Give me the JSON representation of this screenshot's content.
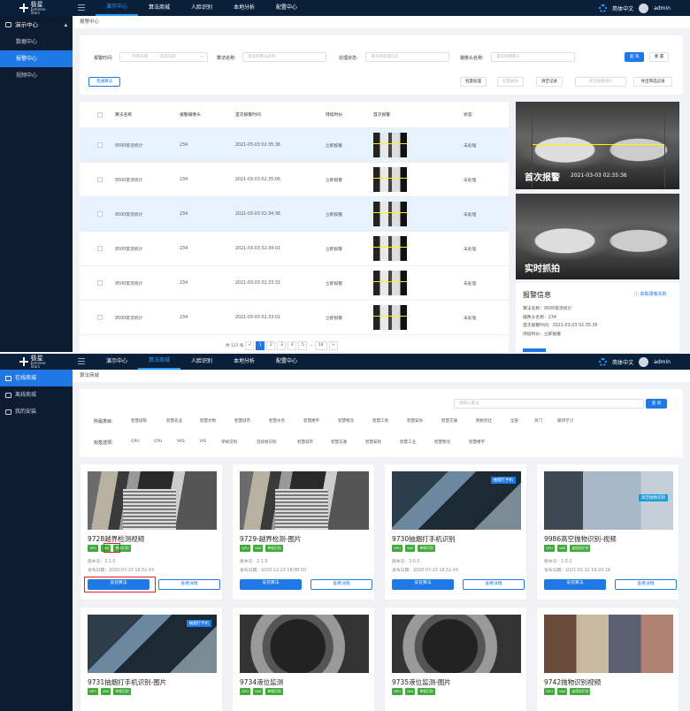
{
  "top": {
    "logo_main": "极星",
    "logo_sub": "Extreme Stars",
    "nav_items": [
      "演示中心",
      "算法商城",
      "人脸识别",
      "本地分析",
      "配置中心"
    ],
    "lang": "简体中文",
    "user": "admin"
  },
  "screen1": {
    "sidebar": {
      "group": "演示中心",
      "items": [
        "数据中心",
        "报警中心",
        "视频中心"
      ]
    },
    "breadcrumb": "报警中心",
    "filters": {
      "time_label": "报警时间:",
      "start_ph": "开始日期",
      "sep": "-",
      "end_ph": "结束日期",
      "algo_label": "算法名称:",
      "algo_ph": "请选择算法名称",
      "status_label": "处理状态:",
      "status_ph": "请选择处理状态",
      "cam_label": "摄像头名称:",
      "cam_ph": "请选择摄像头",
      "query": "查 询",
      "reset": "重 置"
    },
    "actions": {
      "normal": "普通算法",
      "batch": "批量处理",
      "batch_delete": "批量删除",
      "clear": "清空记录",
      "export_img": "导出报警图片",
      "export_rec": "导出筛选记录"
    },
    "table": {
      "headers": [
        "算法名称",
        "报警摄像头",
        "首次报警时间",
        "持续时长",
        "首次报警",
        "状态"
      ],
      "rows": [
        {
          "name": "9500客流统计",
          "cam": "234",
          "time": "2021-03-03 02:35:36",
          "dur": "立即报警",
          "status": "未处理"
        },
        {
          "name": "9500客流统计",
          "cam": "234",
          "time": "2021-03-03 02:35:06",
          "dur": "立即报警",
          "status": "未处理"
        },
        {
          "name": "9500客流统计",
          "cam": "234",
          "time": "2021-03-03 02:34:36",
          "dur": "立即报警",
          "status": "未处理"
        },
        {
          "name": "9500客流统计",
          "cam": "234",
          "time": "2021-03-03 02:34:01",
          "dur": "立即报警",
          "status": "未处理"
        },
        {
          "name": "9500客流统计",
          "cam": "234",
          "time": "2021-03-03 02:33:31",
          "dur": "立即报警",
          "status": "未处理"
        },
        {
          "name": "9500客流统计",
          "cam": "234",
          "time": "2021-03-03 02:33:01",
          "dur": "立即报警",
          "status": "未处理"
        }
      ]
    },
    "pager": {
      "total": "共 137 条",
      "prev": "<",
      "pages": [
        "1",
        "2",
        "3",
        "4",
        "5",
        "···",
        "14"
      ],
      "next": ">"
    },
    "preview": {
      "first_label": "首次报警",
      "first_time": "2021-03-03 02:35:36",
      "live_label": "实时抓拍",
      "info_title": "报警信息",
      "info_link": "获取录像失败",
      "info_lines": [
        "算法名称：9500客流统计",
        "摄像头名称：234",
        "首次报警时间：2021-03-03 02:35:36",
        "持续时长：立即报警"
      ]
    }
  },
  "screen2": {
    "sidebar": {
      "items": [
        "在线商城",
        "离线商城",
        "我的安装"
      ]
    },
    "breadcrumb": "算法商城",
    "search": {
      "placeholder": "请输入算法",
      "button": "查 询"
    },
    "category_label": "所属类目:",
    "categories": [
      "智慧城管",
      "智慧农业",
      "智慧文物",
      "智慧城市",
      "智慧水务",
      "智慧楼宇",
      "智慧物流",
      "智慧工地",
      "智慧安防",
      "智慧交通",
      "明厨亮灶",
      "全部",
      "热门",
      "联邦学习"
    ],
    "tag_label": "标签选项:",
    "tags": [
      "GPU",
      "CPU",
      "VAS",
      "IAS",
      "单帧识别",
      "连续帧识别",
      "智慧城市",
      "智慧交通",
      "智慧安防",
      "智慧工业",
      "智慧物流",
      "智慧楼宇"
    ],
    "cards": [
      {
        "title": "9728越界检测视频",
        "chips": [
          "GPU",
          "VAS",
          "单帧识别"
        ],
        "version": "版本号：2.1.0",
        "date": "发布日期：2020-07-23 16:32:43",
        "install": "安装算法",
        "detail": "查看详情",
        "img_label": ""
      },
      {
        "title": "9729-越界检测-图片",
        "chips": [
          "GPU",
          "VAS",
          "单帧识别"
        ],
        "version": "版本号：2.1.0",
        "date": "发布日期：2020-12-23 18:08:50",
        "install": "安装算法",
        "detail": "查看详情",
        "img_label": ""
      },
      {
        "title": "9730抽烟打手机识别",
        "chips": [
          "GPU",
          "VAS",
          "单帧识别"
        ],
        "version": "版本号：2.0.0",
        "date": "发布日期：2020-07-23 16:32:43",
        "install": "安装算法",
        "detail": "查看详情",
        "img_label": "抽烟打手机"
      },
      {
        "title": "9986高空抛物识别-视频",
        "chips": [
          "GPU",
          "VAS",
          "连续帧识别"
        ],
        "version": "版本号：1.0.2",
        "date": "发布日期：2021-01-12 16:20:18",
        "install": "安装算法",
        "detail": "查看详情",
        "img_label": "高空抛物识别"
      },
      {
        "title": "9731抽烟打手机识别-图片",
        "chips": [
          "GPU",
          "VAS",
          "单帧识别"
        ],
        "img_label": "抽烟打手机"
      },
      {
        "title": "9734液位监测",
        "chips": [
          "GPU",
          "VAS",
          "单帧识别"
        ],
        "img_label": ""
      },
      {
        "title": "9735液位监测-图片",
        "chips": [
          "GPU",
          "VAS",
          "单帧识别"
        ],
        "img_label": ""
      },
      {
        "title": "9742抛物识别视频",
        "chips": [
          "GPU",
          "VAS",
          "连续帧识别"
        ],
        "img_label": ""
      }
    ]
  }
}
